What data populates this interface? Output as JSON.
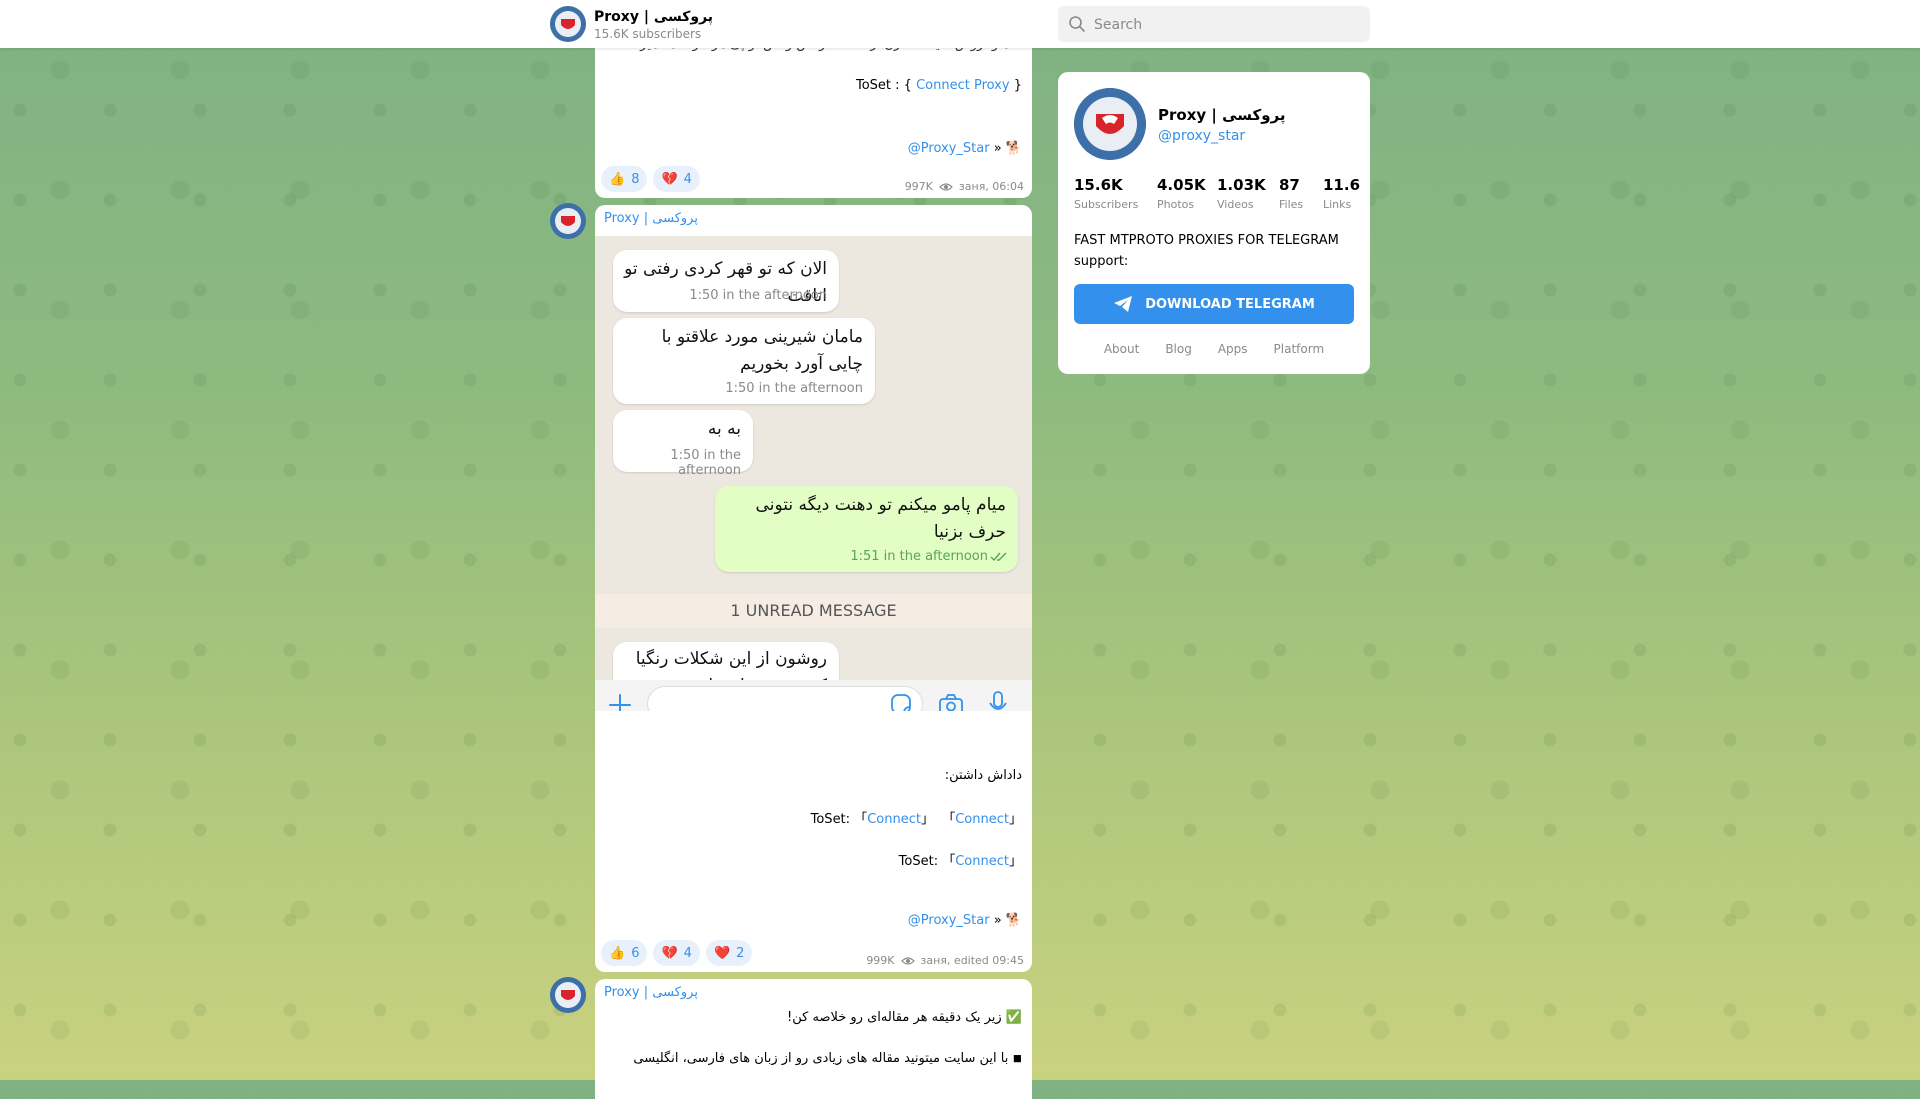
{
  "channel": {
    "title": "Proxy | پروکسی",
    "subscribers_text": "15.6K subscribers",
    "username": "@proxy_star"
  },
  "search": {
    "placeholder": "Search"
  },
  "post1": {
    "partial_text": "…هاو نروش شیشه ادارن ار که ند حرکش وقش تو پی هز حرده هد هیزت",
    "toset_prefix": "ToSet : {",
    "toset_link": "Connect Proxy",
    "toset_suffix": "}",
    "signature_link": "@Proxy_Star",
    "signature_tail": "»",
    "reactions": [
      {
        "emoji": "👍",
        "count": "8"
      },
      {
        "emoji": "💔",
        "count": "4"
      }
    ],
    "views": "997K",
    "time": "заня, 06:04"
  },
  "post2": {
    "author": "Proxy | پروکسی",
    "bubbles": [
      {
        "text": "الان که تو قهر کردی رفتی تو اتاقت",
        "time": "1:50 in the afternoon"
      },
      {
        "text": "مامان شیرینی مورد علاقتو با چایی آورد بخوریم",
        "time": "1:50 in the afternoon"
      },
      {
        "text": "به به",
        "time": "1:50 in the afternoon"
      },
      {
        "text": "میام پامو میکنم تو دهنت دیگه نتونی حرف بزنیا",
        "time": "1:51 in the afternoon"
      },
      {
        "text": "روشون از این شکلات رنگیا که دوست داری ام ریخته",
        "time": ""
      }
    ],
    "unread_label": "1 UNREAD MESSAGE",
    "caption": "داداش داشتن:",
    "toset1_prefix": "ToSet:",
    "connect_label": "Connect",
    "toset2_prefix": "ToSet:",
    "signature_link": "@Proxy_Star",
    "signature_tail": "»",
    "reactions": [
      {
        "emoji": "👍",
        "count": "6"
      },
      {
        "emoji": "💔",
        "count": "4"
      },
      {
        "emoji": "❤️",
        "count": "2"
      }
    ],
    "views": "999K",
    "time": "заня, edited  09:45"
  },
  "post3": {
    "author": "Proxy | پروکسی",
    "line1": "✅ زیر یک دقیقه هر مقاله‌ای رو خلاصه کن!",
    "line2": "◾ با این سایت میتونید مقاله های زیادی رو از زبان های فارسی، انگلیسی"
  },
  "card": {
    "name": "Proxy | پروکسی",
    "username": "@proxy_star",
    "stats": [
      {
        "value": "15.6K",
        "label": "Subscribers"
      },
      {
        "value": "4.05K",
        "label": "Photos"
      },
      {
        "value": "1.03K",
        "label": "Videos"
      },
      {
        "value": "87",
        "label": "Files"
      },
      {
        "value": "11.6",
        "label": "Links"
      }
    ],
    "description_line1": "FAST MTPROTO PROXIES FOR TELEGRAM",
    "description_line2": "support:",
    "download_label": "DOWNLOAD TELEGRAM",
    "footer_links": [
      "About",
      "Blog",
      "Apps",
      "Platform"
    ]
  },
  "colors": {
    "accent": "#3390ec",
    "outgoing_bubble": "#e2fec5"
  }
}
